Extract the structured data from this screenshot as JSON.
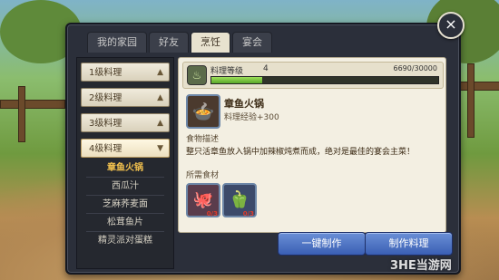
{
  "tabs": [
    {
      "label": "我的家园",
      "active": false
    },
    {
      "label": "好友",
      "active": false
    },
    {
      "label": "烹饪",
      "active": true
    },
    {
      "label": "宴会",
      "active": false
    }
  ],
  "close_icon": "×",
  "categories": [
    {
      "label": "1级料理",
      "open": false
    },
    {
      "label": "2级料理",
      "open": false
    },
    {
      "label": "3级料理",
      "open": false
    },
    {
      "label": "4级料理",
      "open": true
    }
  ],
  "dishes": [
    {
      "label": "章鱼火锅",
      "selected": true
    },
    {
      "label": "西瓜汁",
      "selected": false
    },
    {
      "label": "芝麻荞麦面",
      "selected": false
    },
    {
      "label": "松茸鱼片",
      "selected": false
    },
    {
      "label": "精灵派对蛋糕",
      "selected": false
    }
  ],
  "level": {
    "label": "料理等级",
    "value": "4",
    "exp_text": "6690/30000",
    "progress": 0.223
  },
  "selected_dish": {
    "name": "章鱼火锅",
    "exp": "料理经验+300",
    "icon": "hotpot-icon"
  },
  "description": {
    "title": "食物描述",
    "text": "整只活章鱼放入锅中加辣椒炖煮而成，绝对是最佳的宴会主菜！"
  },
  "ingredients": {
    "title": "所需食材",
    "items": [
      {
        "icon": "octopus-icon",
        "qty": "0/3"
      },
      {
        "icon": "pepper-icon",
        "qty": "0/3"
      }
    ]
  },
  "buttons": {
    "one_click": "一键制作",
    "make": "制作料理"
  },
  "watermark": "3HE当游网",
  "colors": {
    "accent_blue": "#3a5fb4",
    "progress_green": "#58a82a",
    "selected_dish": "#f2c14e",
    "panel_dark": "#2b2f3a",
    "parchment": "#f3efe2"
  }
}
